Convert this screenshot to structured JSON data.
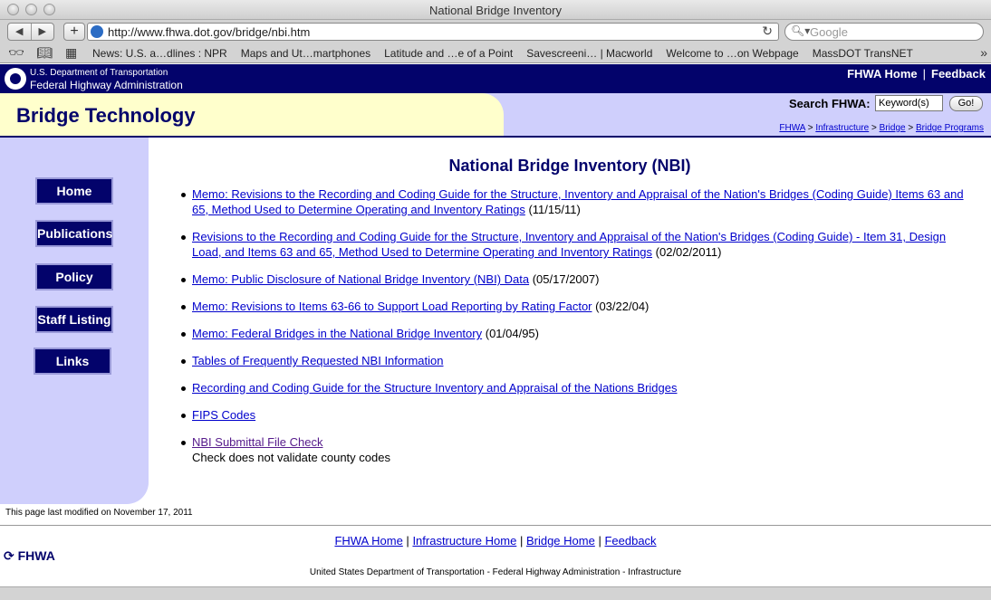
{
  "browser": {
    "window_title": "National Bridge Inventory",
    "url": "http://www.fhwa.dot.gov/bridge/nbi.htm",
    "search_placeholder": "Google",
    "bookmarks": [
      "News: U.S. a…dlines : NPR",
      "Maps and Ut…martphones",
      "Latitude and …e of a Point",
      "Savescreeni… | Macworld",
      "Welcome to …on Webpage",
      "MassDOT TransNET"
    ],
    "icons": [
      "back-arrow-icon",
      "forward-arrow-icon",
      "plus-icon",
      "globe-icon",
      "reload-icon",
      "search-icon",
      "reading-glasses-icon",
      "book-icon",
      "grid-icon",
      "chevron-more-icon"
    ]
  },
  "header": {
    "dot_line1": "U.S. Department of Transportation",
    "dot_line2": "Federal Highway Administration",
    "fhwa_home": "FHWA Home",
    "feedback": "Feedback",
    "sep": "|"
  },
  "banner": {
    "site_title": "Bridge Technology",
    "search_label": "Search FHWA:",
    "search_value": "Keyword(s)",
    "go": "Go!",
    "crumbs": [
      "FHWA",
      "Infrastructure",
      "Bridge",
      "Bridge Programs"
    ],
    "crumb_sep": ">"
  },
  "sidebar": {
    "items": [
      "Home",
      "Publications",
      "Policy",
      "Staff Listing",
      "Links"
    ]
  },
  "main": {
    "title": "National Bridge Inventory (NBI)",
    "docs": [
      {
        "link": "Memo: Revisions to the Recording and Coding Guide for the Structure, Inventory and Appraisal of the Nation's Bridges (Coding Guide) Items 63 and 65, Method Used to Determine Operating and Inventory Ratings",
        "date": "(11/15/11)"
      },
      {
        "link": "Revisions to the Recording and Coding Guide for the Structure, Inventory and Appraisal of the Nation's Bridges (Coding Guide) - Item 31, Design Load, and Items 63 and 65, Method Used to Determine Operating and Inventory Ratings",
        "date": "(02/02/2011)"
      },
      {
        "link": "Memo: Public Disclosure of National Bridge Inventory (NBI) Data",
        "date": "(05/17/2007)"
      },
      {
        "link": "Memo: Revisions to Items 63-66 to Support Load Reporting by Rating Factor",
        "date": "(03/22/04)"
      },
      {
        "link": "Memo: Federal Bridges in the National Bridge Inventory",
        "date": "(01/04/95)"
      },
      {
        "link": "Tables of Frequently Requested NBI Information",
        "date": ""
      },
      {
        "link": "Recording and Coding Guide for the Structure Inventory and Appraisal of the Nations Bridges",
        "date": ""
      },
      {
        "link": "FIPS Codes",
        "date": ""
      },
      {
        "link": "NBI Submittal File Check",
        "date": "",
        "note": "Check does not validate county codes"
      }
    ]
  },
  "footer": {
    "last_modified": "This page last modified on November 17, 2011",
    "logo": "FHWA",
    "links": [
      "FHWA Home",
      "Infrastructure Home",
      "Bridge Home",
      "Feedback"
    ],
    "sep": "|",
    "credit": "United States Department of Transportation - Federal Highway Administration - Infrastructure"
  }
}
